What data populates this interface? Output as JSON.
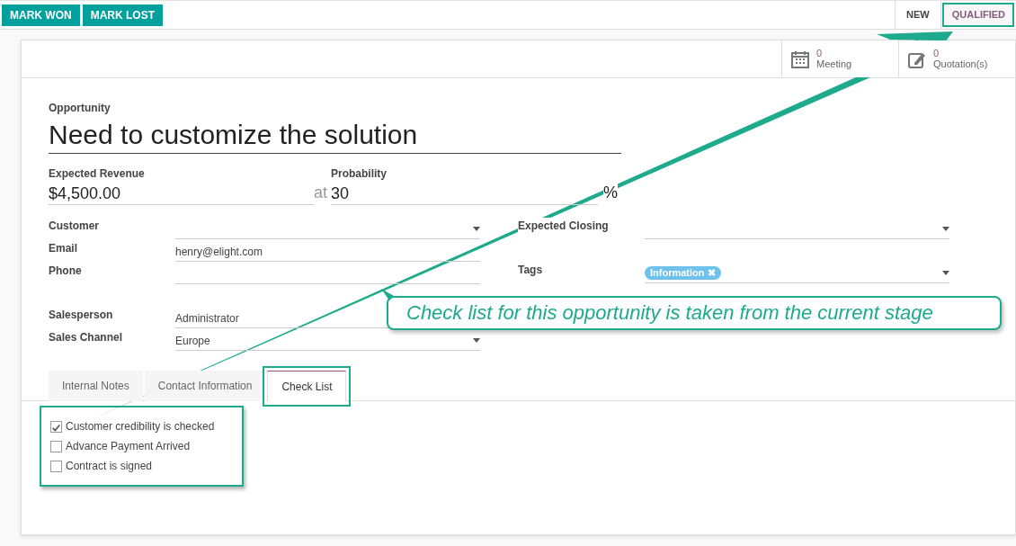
{
  "actions": [
    "MARK WON",
    "MARK LOST"
  ],
  "stages": [
    {
      "label": "NEW",
      "selected": false,
      "highlighted": false
    },
    {
      "label": "QUALIFIED",
      "selected": true,
      "highlighted": true
    }
  ],
  "smart_buttons": [
    {
      "kind": "calendar",
      "count": "0",
      "label": "Meeting"
    },
    {
      "kind": "quote",
      "count": "0",
      "label": "Quotation(s)"
    }
  ],
  "opportunity": {
    "label": "Opportunity",
    "name": "Need to customize the solution"
  },
  "revenue": {
    "label": "Expected Revenue",
    "value": "$4,500.00",
    "joiner": "at"
  },
  "probability": {
    "label": "Probability",
    "value": "30",
    "unit": "%"
  },
  "left_fields": [
    {
      "label": "Customer",
      "kind": "select"
    },
    {
      "label": "Email",
      "kind": "text",
      "value": "henry@elight.com"
    },
    {
      "label": "Phone",
      "kind": "text"
    },
    {
      "label": "Salesperson",
      "kind": "text",
      "value": "Administrator",
      "gap_before": true
    },
    {
      "label": "Sales Channel",
      "kind": "select",
      "value": "Europe"
    }
  ],
  "right_fields": [
    {
      "label": "Expected Closing",
      "kind": "select"
    },
    {
      "label": "Tags",
      "kind": "select",
      "tags": [
        {
          "label": "Information",
          "remove": "✖"
        }
      ],
      "gap_before": true
    }
  ],
  "tabs": [
    {
      "label": "Internal Notes",
      "selected": false,
      "highlighted": false
    },
    {
      "label": "Contact Information",
      "selected": false,
      "highlighted": false
    },
    {
      "label": "Check List",
      "selected": true,
      "highlighted": true
    }
  ],
  "checklist": {
    "highlighted": true,
    "items": [
      {
        "label": "Customer credibility is checked",
        "checked": true
      },
      {
        "label": "Advance Payment Arrived",
        "checked": false
      },
      {
        "label": "Contract is signed",
        "checked": false
      }
    ]
  },
  "callout": "Check list for this opportunity is taken from the current stage"
}
